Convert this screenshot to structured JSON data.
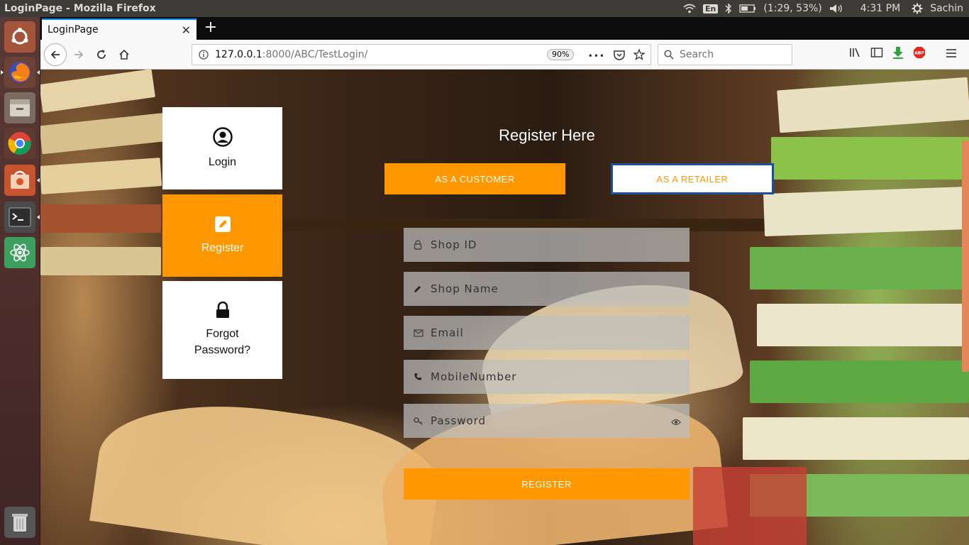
{
  "os": {
    "window_title": "LoginPage - Mozilla Firefox",
    "keyboard": "En",
    "battery": "(1:29, 53%)",
    "clock": "4:31 PM",
    "user": "Sachin",
    "indicators": [
      "wifi-icon",
      "bluetooth-icon",
      "battery-icon",
      "volume-icon",
      "gear-icon"
    ]
  },
  "launcher": {
    "apps": [
      "ubuntu-dash-icon",
      "firefox-icon",
      "files-icon",
      "chrome-icon",
      "software-center-icon",
      "terminal-icon",
      "atom-icon",
      "trash-icon"
    ]
  },
  "browser": {
    "tab_title": "LoginPage",
    "new_tab": "+",
    "url_host": "127.0.0.1",
    "url_path": ":8000/ABC/TestLogin/",
    "zoom": "90%",
    "page_actions": "•••",
    "search_placeholder": "Search"
  },
  "page": {
    "sidebar": {
      "login": "Login",
      "register": "Register",
      "forgot": "Forgot Password?"
    },
    "title": "Register Here",
    "customer_btn": "AS A CUSTOMER",
    "retailer_btn": "AS A RETAILER",
    "fields": {
      "shop_id": "Shop ID",
      "shop_name": "Shop Name",
      "email": "Email",
      "mobile": "MobileNumber",
      "password": "Password"
    },
    "register_btn": "REGISTER"
  },
  "colors": {
    "accent": "#ff9800",
    "retailer_border": "#1c4f9c",
    "tab_highlight": "#0a84ff"
  }
}
